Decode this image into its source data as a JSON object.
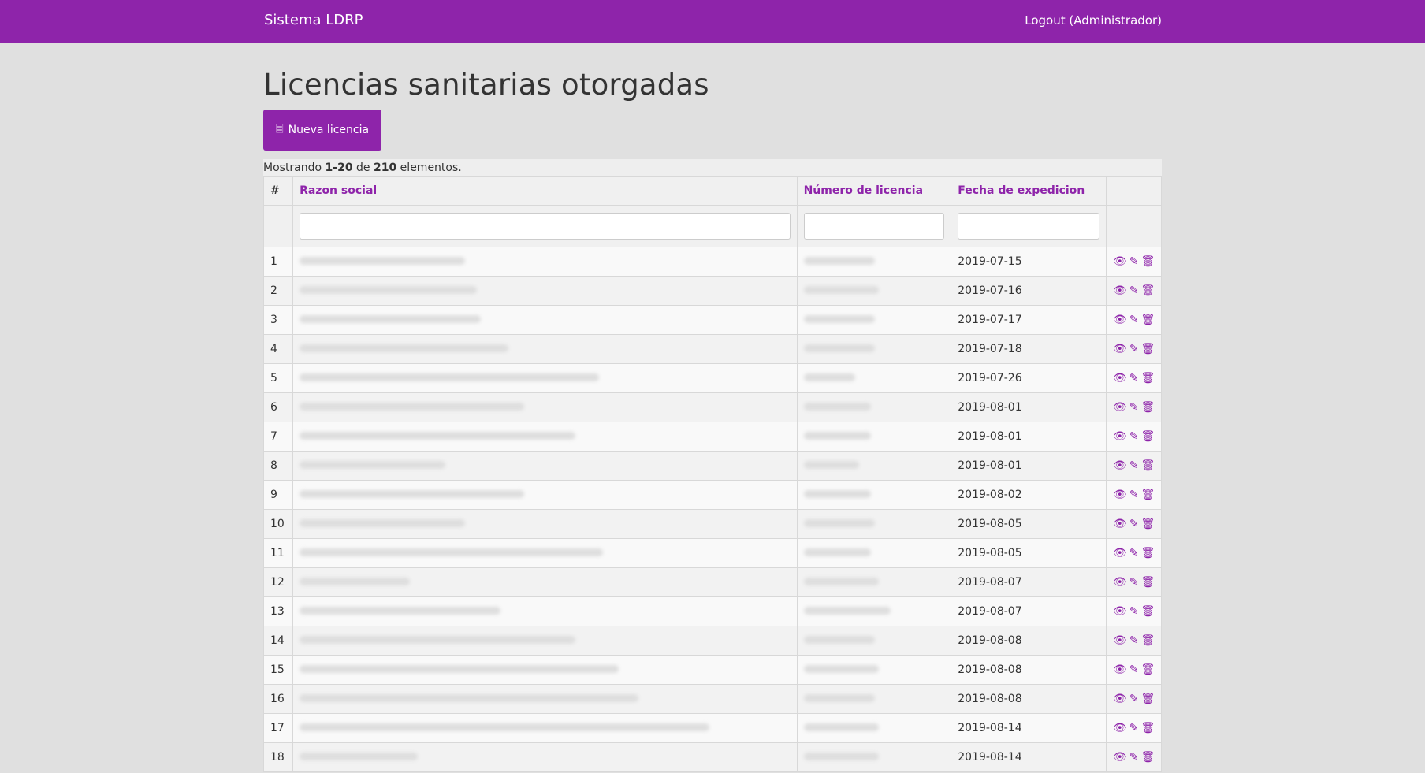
{
  "navbar": {
    "brand": "Sistema LDRP",
    "logout": "Logout (Administrador)"
  },
  "page_title": "Licencias sanitarias otorgadas",
  "new_button_label": "Nueva licencia",
  "summary": {
    "prefix": "Mostrando ",
    "range": "1-20",
    "mid": " de ",
    "total": "210",
    "suffix": " elementos."
  },
  "columns": {
    "num": "#",
    "razon": "Razon social",
    "numero": "Número de licencia",
    "fecha": "Fecha de expedicion"
  },
  "icons": {
    "view": "eye-icon",
    "edit": "pencil-icon",
    "delete": "trash-icon",
    "new": "document-icon"
  },
  "colors": {
    "accent": "#8e24aa"
  },
  "rows": [
    {
      "n": "1",
      "fecha": "2019-07-15"
    },
    {
      "n": "2",
      "fecha": "2019-07-16"
    },
    {
      "n": "3",
      "fecha": "2019-07-17"
    },
    {
      "n": "4",
      "fecha": "2019-07-18"
    },
    {
      "n": "5",
      "fecha": "2019-07-26"
    },
    {
      "n": "6",
      "fecha": "2019-08-01"
    },
    {
      "n": "7",
      "fecha": "2019-08-01"
    },
    {
      "n": "8",
      "fecha": "2019-08-01"
    },
    {
      "n": "9",
      "fecha": "2019-08-02"
    },
    {
      "n": "10",
      "fecha": "2019-08-05"
    },
    {
      "n": "11",
      "fecha": "2019-08-05"
    },
    {
      "n": "12",
      "fecha": "2019-08-07"
    },
    {
      "n": "13",
      "fecha": "2019-08-07"
    },
    {
      "n": "14",
      "fecha": "2019-08-08"
    },
    {
      "n": "15",
      "fecha": "2019-08-08"
    },
    {
      "n": "16",
      "fecha": "2019-08-08"
    },
    {
      "n": "17",
      "fecha": "2019-08-14"
    },
    {
      "n": "18",
      "fecha": "2019-08-14"
    }
  ]
}
